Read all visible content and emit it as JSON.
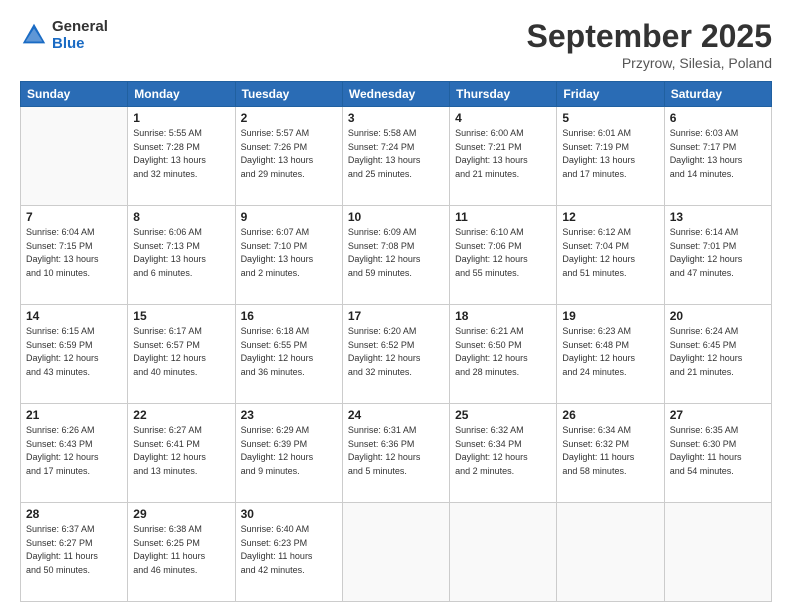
{
  "logo": {
    "line1": "General",
    "line2": "Blue"
  },
  "title": "September 2025",
  "location": "Przyrow, Silesia, Poland",
  "days_header": [
    "Sunday",
    "Monday",
    "Tuesday",
    "Wednesday",
    "Thursday",
    "Friday",
    "Saturday"
  ],
  "weeks": [
    [
      {
        "num": "",
        "info": ""
      },
      {
        "num": "1",
        "info": "Sunrise: 5:55 AM\nSunset: 7:28 PM\nDaylight: 13 hours\nand 32 minutes."
      },
      {
        "num": "2",
        "info": "Sunrise: 5:57 AM\nSunset: 7:26 PM\nDaylight: 13 hours\nand 29 minutes."
      },
      {
        "num": "3",
        "info": "Sunrise: 5:58 AM\nSunset: 7:24 PM\nDaylight: 13 hours\nand 25 minutes."
      },
      {
        "num": "4",
        "info": "Sunrise: 6:00 AM\nSunset: 7:21 PM\nDaylight: 13 hours\nand 21 minutes."
      },
      {
        "num": "5",
        "info": "Sunrise: 6:01 AM\nSunset: 7:19 PM\nDaylight: 13 hours\nand 17 minutes."
      },
      {
        "num": "6",
        "info": "Sunrise: 6:03 AM\nSunset: 7:17 PM\nDaylight: 13 hours\nand 14 minutes."
      }
    ],
    [
      {
        "num": "7",
        "info": "Sunrise: 6:04 AM\nSunset: 7:15 PM\nDaylight: 13 hours\nand 10 minutes."
      },
      {
        "num": "8",
        "info": "Sunrise: 6:06 AM\nSunset: 7:13 PM\nDaylight: 13 hours\nand 6 minutes."
      },
      {
        "num": "9",
        "info": "Sunrise: 6:07 AM\nSunset: 7:10 PM\nDaylight: 13 hours\nand 2 minutes."
      },
      {
        "num": "10",
        "info": "Sunrise: 6:09 AM\nSunset: 7:08 PM\nDaylight: 12 hours\nand 59 minutes."
      },
      {
        "num": "11",
        "info": "Sunrise: 6:10 AM\nSunset: 7:06 PM\nDaylight: 12 hours\nand 55 minutes."
      },
      {
        "num": "12",
        "info": "Sunrise: 6:12 AM\nSunset: 7:04 PM\nDaylight: 12 hours\nand 51 minutes."
      },
      {
        "num": "13",
        "info": "Sunrise: 6:14 AM\nSunset: 7:01 PM\nDaylight: 12 hours\nand 47 minutes."
      }
    ],
    [
      {
        "num": "14",
        "info": "Sunrise: 6:15 AM\nSunset: 6:59 PM\nDaylight: 12 hours\nand 43 minutes."
      },
      {
        "num": "15",
        "info": "Sunrise: 6:17 AM\nSunset: 6:57 PM\nDaylight: 12 hours\nand 40 minutes."
      },
      {
        "num": "16",
        "info": "Sunrise: 6:18 AM\nSunset: 6:55 PM\nDaylight: 12 hours\nand 36 minutes."
      },
      {
        "num": "17",
        "info": "Sunrise: 6:20 AM\nSunset: 6:52 PM\nDaylight: 12 hours\nand 32 minutes."
      },
      {
        "num": "18",
        "info": "Sunrise: 6:21 AM\nSunset: 6:50 PM\nDaylight: 12 hours\nand 28 minutes."
      },
      {
        "num": "19",
        "info": "Sunrise: 6:23 AM\nSunset: 6:48 PM\nDaylight: 12 hours\nand 24 minutes."
      },
      {
        "num": "20",
        "info": "Sunrise: 6:24 AM\nSunset: 6:45 PM\nDaylight: 12 hours\nand 21 minutes."
      }
    ],
    [
      {
        "num": "21",
        "info": "Sunrise: 6:26 AM\nSunset: 6:43 PM\nDaylight: 12 hours\nand 17 minutes."
      },
      {
        "num": "22",
        "info": "Sunrise: 6:27 AM\nSunset: 6:41 PM\nDaylight: 12 hours\nand 13 minutes."
      },
      {
        "num": "23",
        "info": "Sunrise: 6:29 AM\nSunset: 6:39 PM\nDaylight: 12 hours\nand 9 minutes."
      },
      {
        "num": "24",
        "info": "Sunrise: 6:31 AM\nSunset: 6:36 PM\nDaylight: 12 hours\nand 5 minutes."
      },
      {
        "num": "25",
        "info": "Sunrise: 6:32 AM\nSunset: 6:34 PM\nDaylight: 12 hours\nand 2 minutes."
      },
      {
        "num": "26",
        "info": "Sunrise: 6:34 AM\nSunset: 6:32 PM\nDaylight: 11 hours\nand 58 minutes."
      },
      {
        "num": "27",
        "info": "Sunrise: 6:35 AM\nSunset: 6:30 PM\nDaylight: 11 hours\nand 54 minutes."
      }
    ],
    [
      {
        "num": "28",
        "info": "Sunrise: 6:37 AM\nSunset: 6:27 PM\nDaylight: 11 hours\nand 50 minutes."
      },
      {
        "num": "29",
        "info": "Sunrise: 6:38 AM\nSunset: 6:25 PM\nDaylight: 11 hours\nand 46 minutes."
      },
      {
        "num": "30",
        "info": "Sunrise: 6:40 AM\nSunset: 6:23 PM\nDaylight: 11 hours\nand 42 minutes."
      },
      {
        "num": "",
        "info": ""
      },
      {
        "num": "",
        "info": ""
      },
      {
        "num": "",
        "info": ""
      },
      {
        "num": "",
        "info": ""
      }
    ]
  ]
}
